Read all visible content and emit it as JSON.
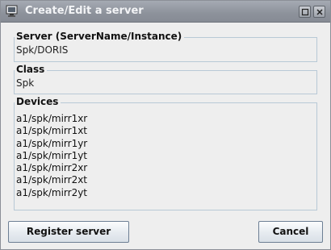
{
  "window": {
    "title": "Create/Edit a server",
    "app_icon": "monitor-icon",
    "maximize_icon": "maximize-icon",
    "close_icon": "close-icon"
  },
  "server": {
    "label": "Server  (ServerName/Instance)",
    "value": "Spk/DORIS"
  },
  "class": {
    "label": "Class",
    "value": "Spk"
  },
  "devices": {
    "label": "Devices",
    "items": [
      "a1/spk/mirr1xr",
      "a1/spk/mirr1xt",
      "a1/spk/mirr1yr",
      "a1/spk/mirr1yt",
      "a1/spk/mirr2xr",
      "a1/spk/mirr2xt",
      "a1/spk/mirr2yt"
    ]
  },
  "buttons": {
    "register_label": "Register server",
    "cancel_label": "Cancel"
  }
}
